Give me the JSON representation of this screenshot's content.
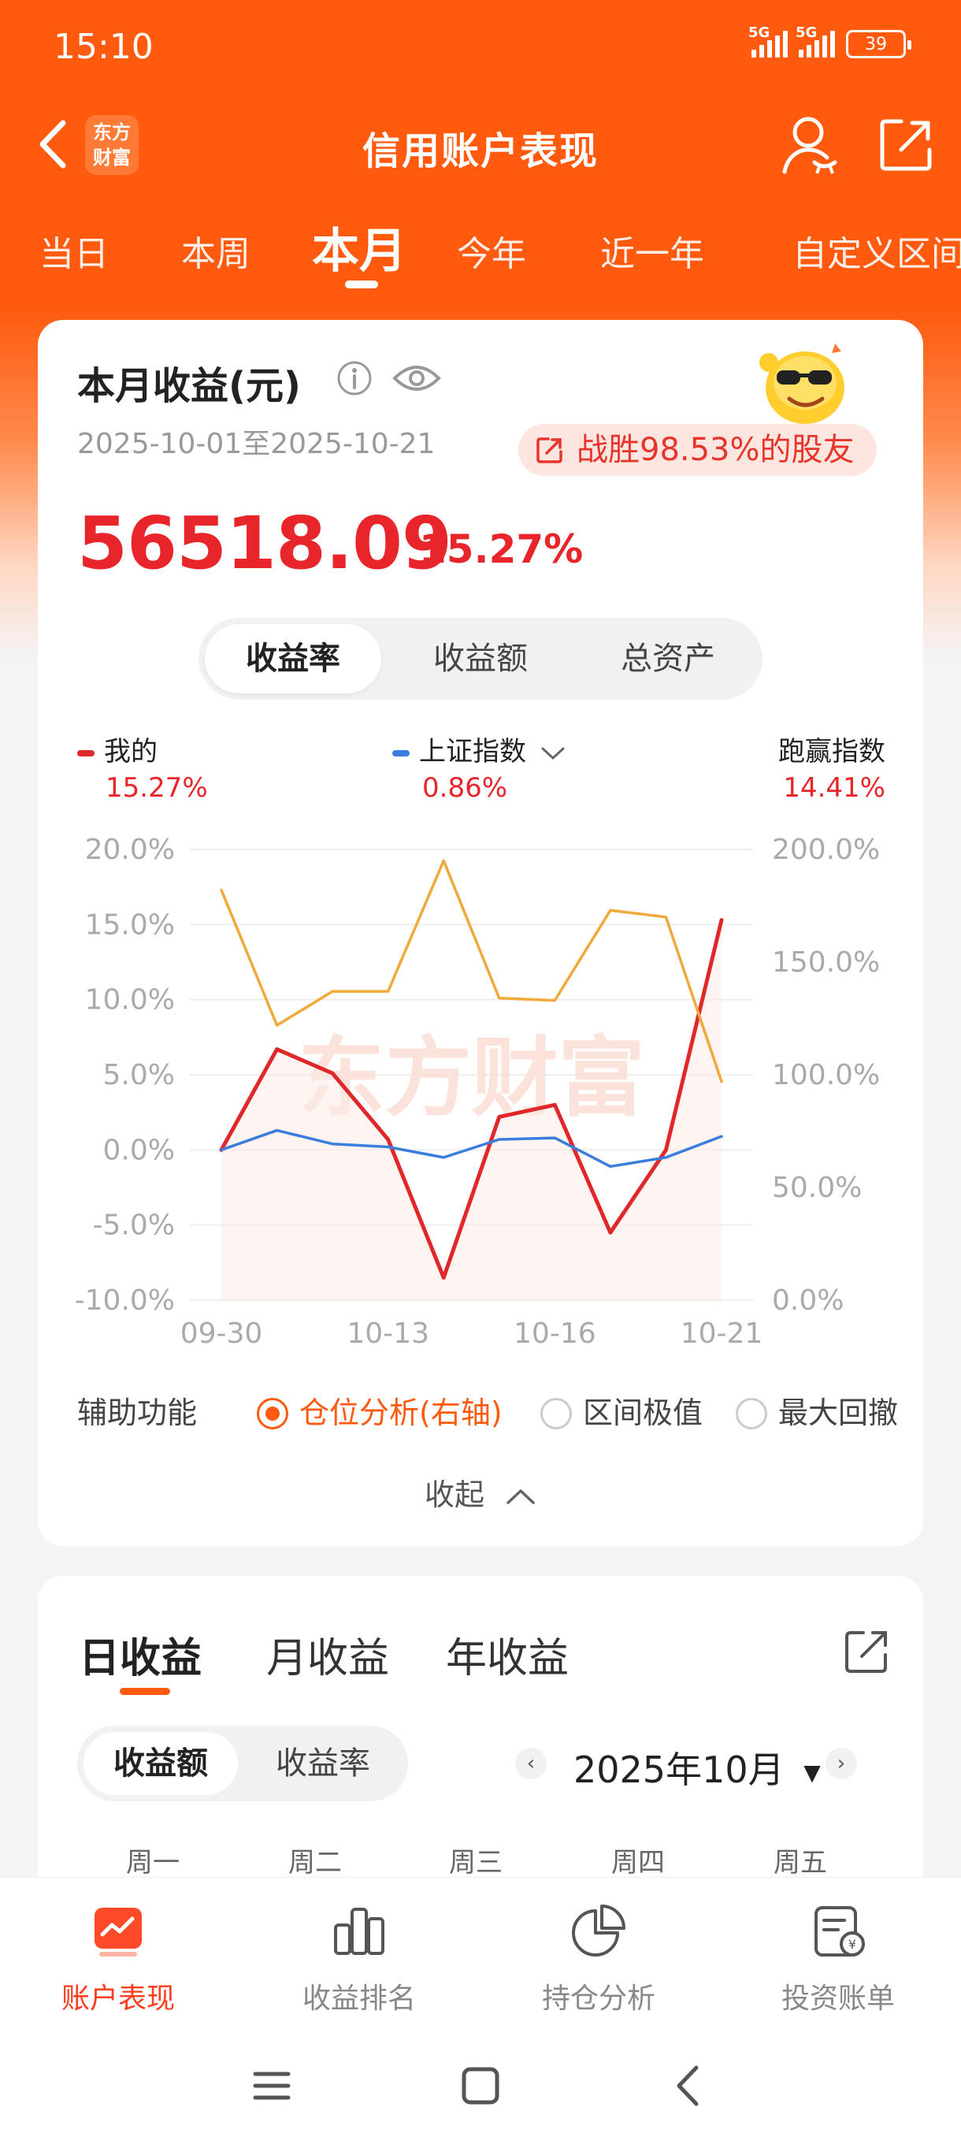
{
  "status": {
    "time": "15:10",
    "net1": "5G",
    "net2": "5G",
    "battery": "39"
  },
  "header": {
    "title": "信用账户表现",
    "logo_line1": "东方",
    "logo_line2": "财富"
  },
  "tabs": [
    {
      "label": "当日"
    },
    {
      "label": "本周"
    },
    {
      "label": "本月"
    },
    {
      "label": "今年"
    },
    {
      "label": "近一年"
    },
    {
      "label": "自定义区间"
    }
  ],
  "summary": {
    "title": "本月收益(元)",
    "date_range": "2025-10-01至2025-10-21",
    "beat_text": "战胜98.53%的股友",
    "amount": "56518.09",
    "rate": "15.27%"
  },
  "segment": {
    "items": [
      "收益率",
      "收益额",
      "总资产"
    ],
    "active": "收益率"
  },
  "legend": {
    "mine_label": "我的",
    "mine_value": "15.27%",
    "index_label": "上证指数",
    "index_value": "0.86%",
    "beat_label": "跑赢指数",
    "beat_value": "14.41%"
  },
  "chart_data": {
    "type": "line",
    "x_ticks": [
      "09-30",
      "10-13",
      "10-16",
      "10-21"
    ],
    "x_index": [
      0,
      1,
      2,
      3,
      4,
      5,
      6,
      7,
      8,
      9
    ],
    "y_left": {
      "ticks": [
        "20.0%",
        "15.0%",
        "10.0%",
        "5.0%",
        "0.0%",
        "-5.0%",
        "-10.0%"
      ],
      "lim": [
        -10,
        20
      ]
    },
    "y_right": {
      "ticks": [
        "200.0%",
        "150.0%",
        "100.0%",
        "50.0%",
        "0.0%"
      ],
      "lim": [
        0,
        200
      ]
    },
    "series": [
      {
        "name": "我的",
        "axis": "left",
        "color": "#e0282b",
        "values": [
          0.0,
          6.7,
          5.1,
          0.7,
          -8.5,
          2.2,
          3.0,
          -5.5,
          0.0,
          15.3
        ]
      },
      {
        "name": "上证指数",
        "axis": "left",
        "color": "#3b7ddd",
        "values": [
          0.0,
          1.3,
          0.4,
          0.2,
          -0.5,
          0.7,
          0.8,
          -1.1,
          -0.5,
          0.9
        ]
      },
      {
        "axis": "right",
        "color": "#f0a93a",
        "values": [
          182,
          122,
          137,
          137,
          195,
          134,
          133,
          173,
          170,
          97
        ]
      }
    ],
    "grid": true,
    "watermark": "东方财富"
  },
  "aux": {
    "label": "辅助功能",
    "options": [
      {
        "label": "仓位分析(右轴)",
        "on": true
      },
      {
        "label": "区间极值",
        "on": false
      },
      {
        "label": "最大回撤",
        "on": false
      }
    ],
    "collapse": "收起"
  },
  "income": {
    "tabs": [
      "日收益",
      "月收益",
      "年收益"
    ],
    "seg": [
      "收益额",
      "收益率"
    ],
    "month": "2025年10月",
    "weekdays": [
      "周一",
      "周二",
      "周三",
      "周四",
      "周五"
    ]
  },
  "bottom_nav": [
    {
      "label": "账户表现",
      "icon": "account-chart-icon"
    },
    {
      "label": "收益排名",
      "icon": "ranking-bars-icon"
    },
    {
      "label": "持仓分析",
      "icon": "pie-chart-icon"
    },
    {
      "label": "投资账单",
      "icon": "bill-icon"
    }
  ],
  "colors": {
    "brand": "#ff5a0e",
    "up": "#e8252a",
    "index": "#3b7ddd",
    "position": "#f0a93a"
  }
}
